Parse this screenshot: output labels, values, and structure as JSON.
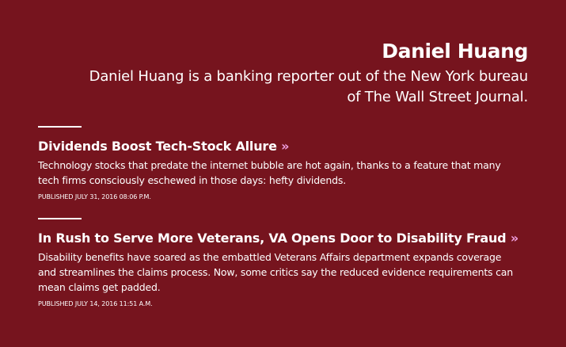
{
  "author": {
    "name": "Daniel Huang",
    "bio": "Daniel Huang is a banking reporter out of the New York bureau of The Wall Street Journal."
  },
  "articles": [
    {
      "headline": "Dividends Boost Tech-Stock Allure",
      "arrow": "»",
      "summary": "Technology stocks that predate the internet bubble are hot again, thanks to a feature that many tech firms consciously eschewed in those days: hefty dividends.",
      "published": "PUBLISHED JULY 31, 2016 08:06 P.M."
    },
    {
      "headline": "In Rush to Serve More Veterans, VA Opens Door to Disability Fraud",
      "arrow": "»",
      "summary": "Disability benefits have soared as the embattled Veterans Affairs department expands coverage and streamlines the claims process. Now, some critics say the reduced evidence requirements can mean claims get padded.",
      "published": "PUBLISHED JULY 14, 2016 11:51 A.M."
    }
  ],
  "colors": {
    "background": "#76141e",
    "text": "#ffffff",
    "arrow": "#f0a0e0"
  },
  "icons": {
    "headline_arrow": "double-chevron-right-icon"
  }
}
